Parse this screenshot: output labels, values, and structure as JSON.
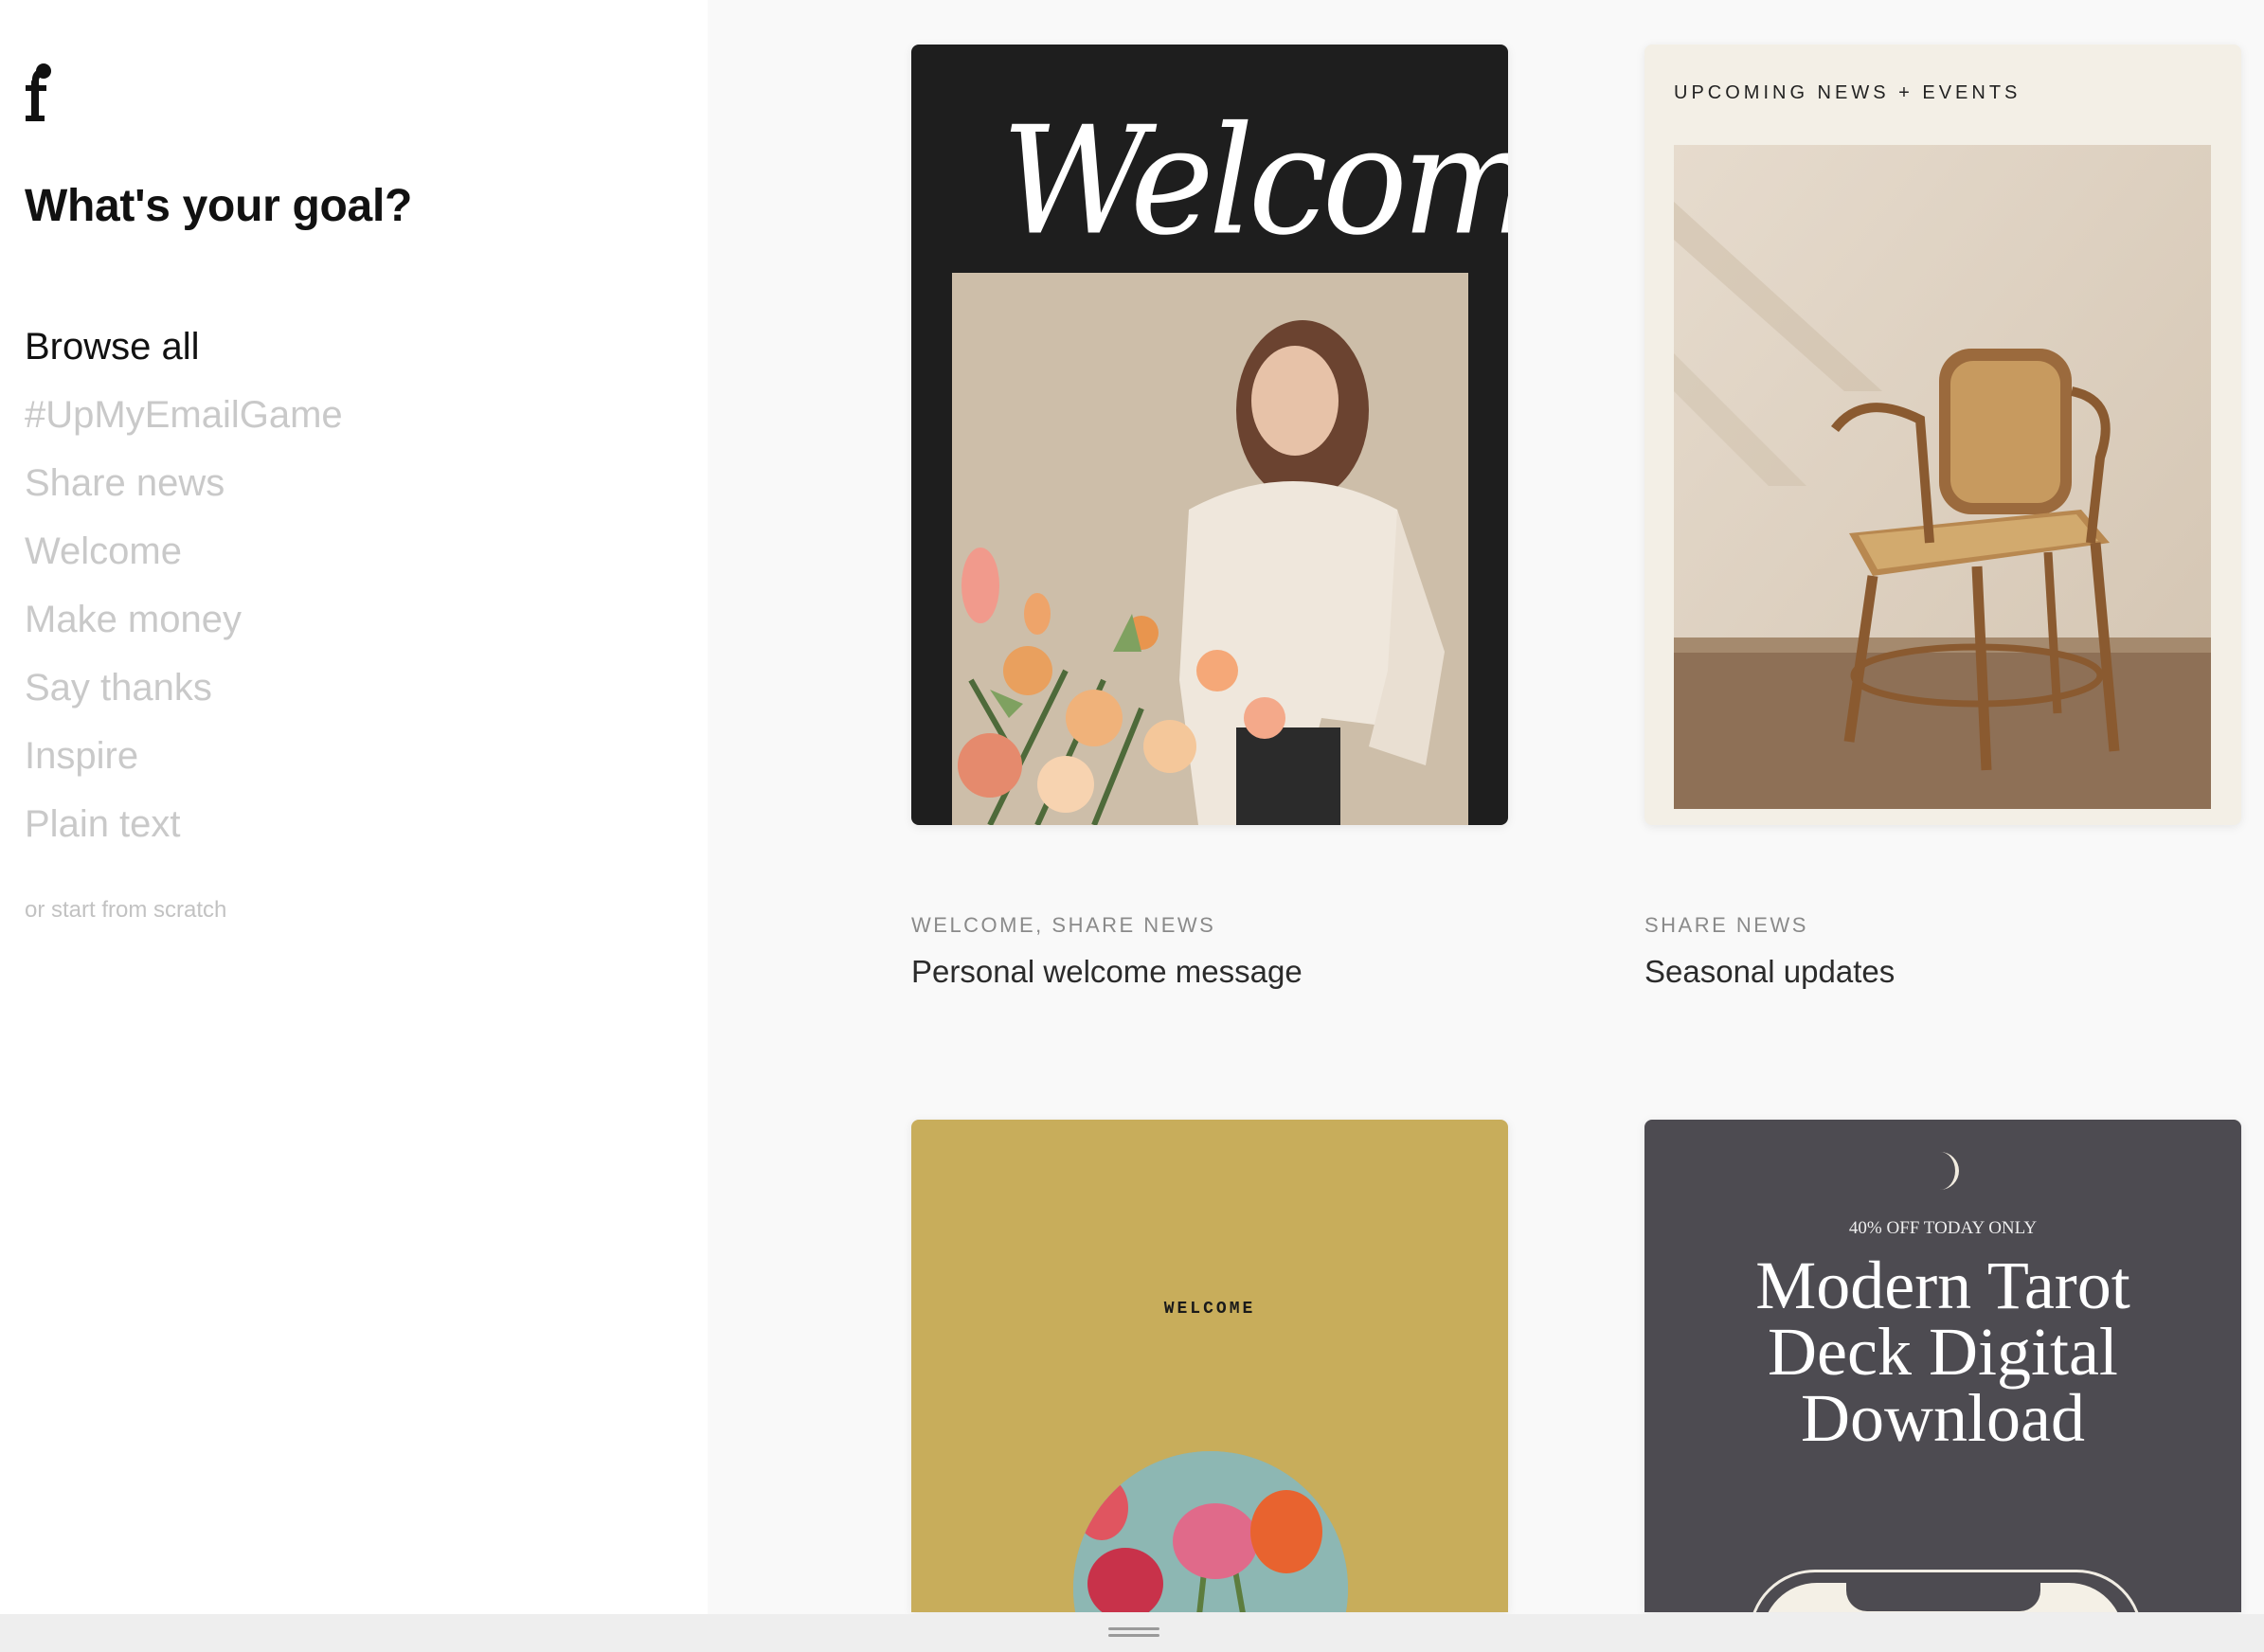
{
  "brand": {
    "logo_letter": "f"
  },
  "sidebar": {
    "title": "What's your goal?",
    "goals": [
      {
        "label": "Browse all",
        "active": true
      },
      {
        "label": "#UpMyEmailGame",
        "active": false
      },
      {
        "label": "Share news",
        "active": false
      },
      {
        "label": "Welcome",
        "active": false
      },
      {
        "label": "Make money",
        "active": false
      },
      {
        "label": "Say thanks",
        "active": false
      },
      {
        "label": "Inspire",
        "active": false
      },
      {
        "label": "Plain text",
        "active": false
      }
    ],
    "scratch_link": "or start from scratch"
  },
  "templates": [
    {
      "tags": "WELCOME, SHARE NEWS",
      "name": "Personal welcome message",
      "preview": {
        "script_text": "Welcome"
      }
    },
    {
      "tags": "SHARE NEWS",
      "name": "Seasonal updates",
      "preview": {
        "header": "UPCOMING NEWS + EVENTS"
      }
    },
    {
      "preview": {
        "small_title": "WELCOME"
      }
    },
    {
      "preview": {
        "offer": "40% OFF TODAY ONLY",
        "title_lines": [
          "Modern Tarot",
          "Deck Digital",
          "Download"
        ]
      }
    }
  ],
  "colors": {
    "sidebar_bg": "#ffffff",
    "content_bg": "#f9f9f9",
    "active_text": "#111111",
    "inactive_text": "#c9c9c9",
    "card1_bg": "#1e1e1e",
    "card2_bg": "#f3efe6",
    "card3_bg": "#c8ad5b",
    "card4_bg": "#4d4b51"
  }
}
